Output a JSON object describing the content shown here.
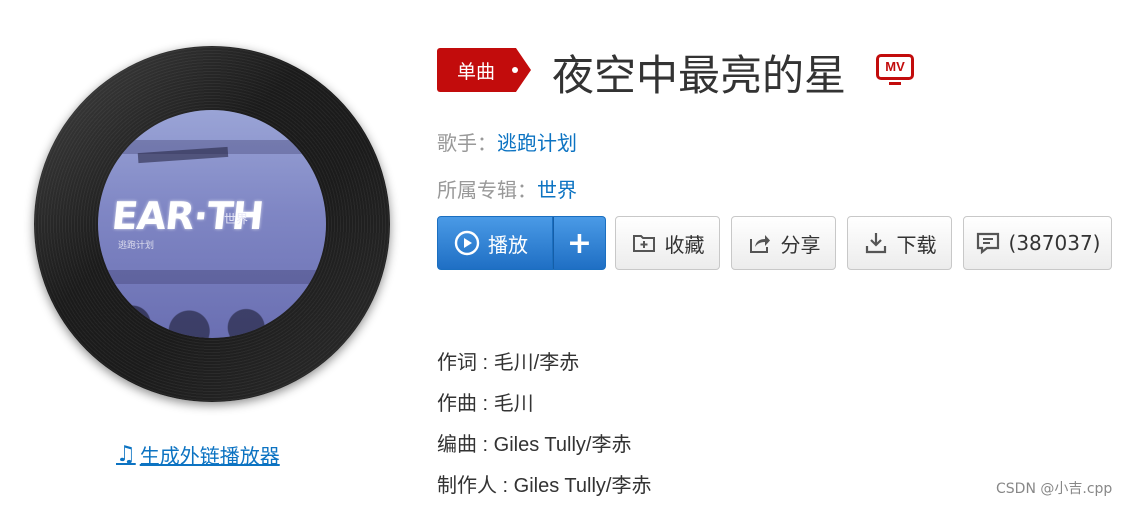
{
  "song": {
    "type_tag": "单曲",
    "title": "夜空中最亮的星",
    "mv_label": "MV",
    "singer_label": "歌手：",
    "singer": "逃跑计划",
    "album_label": "所属专辑：",
    "album": "世界"
  },
  "cover": {
    "logo_text": "EAR·TH",
    "world_text": "世界",
    "sub_text": "逃跑计划"
  },
  "actions": {
    "play_label": "播放",
    "add_label": "+",
    "fav_label": "收藏",
    "share_label": "分享",
    "download_label": "下载",
    "comment_label": "(387037)"
  },
  "credits": [
    {
      "text": "作词 : 毛川/李赤"
    },
    {
      "text": "作曲 : 毛川"
    },
    {
      "text": "编曲 : Giles Tully/李赤"
    },
    {
      "text": "制作人 : Giles Tully/李赤"
    }
  ],
  "external_player_link": "生成外链播放器",
  "watermark": "CSDN @小吉.cpp",
  "colors": {
    "brand_red": "#c20c0c",
    "link_blue": "#0c73c2",
    "play_blue": "#2b7fd4"
  },
  "icons": [
    "music-note-icon",
    "play-circle-icon",
    "add-folder-icon",
    "share-icon",
    "download-icon",
    "comment-icon",
    "mv-icon"
  ]
}
